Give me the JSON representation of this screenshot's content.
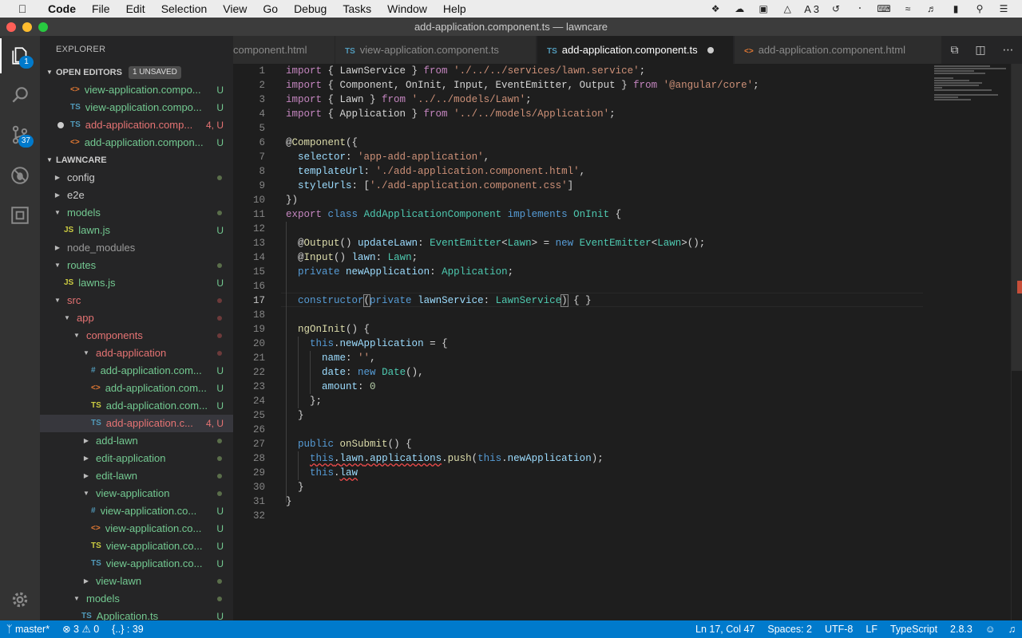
{
  "menubar": {
    "app": "Code",
    "items": [
      "File",
      "Edit",
      "Selection",
      "View",
      "Go",
      "Debug",
      "Tasks",
      "Window",
      "Help"
    ],
    "status_badge": "3"
  },
  "window": {
    "title": "add-application.component.ts — lawncare"
  },
  "activity": {
    "explorer_badge": "1",
    "scm_badge": "37"
  },
  "sidebar": {
    "title": "EXPLORER",
    "open_editors": {
      "label": "OPEN EDITORS",
      "unsaved": "1 UNSAVED",
      "items": [
        {
          "name": "view-application.compo...",
          "icon": "<>",
          "status": "U"
        },
        {
          "name": "view-application.compo...",
          "icon": "TS",
          "status": "U"
        },
        {
          "name": "add-application.comp...",
          "icon": "TS",
          "status": "4, U"
        },
        {
          "name": "add-application.compon...",
          "icon": "<>",
          "status": "U"
        }
      ]
    },
    "project": {
      "label": "LAWNCARE",
      "items": [
        {
          "name": "config"
        },
        {
          "name": "e2e"
        },
        {
          "name": "models"
        },
        {
          "name": "lawn.js",
          "icon": "JS",
          "status": "U"
        },
        {
          "name": "node_modules"
        },
        {
          "name": "routes"
        },
        {
          "name": "lawns.js",
          "icon": "JS",
          "status": "U"
        },
        {
          "name": "src"
        },
        {
          "name": "app"
        },
        {
          "name": "components"
        },
        {
          "name": "add-application"
        },
        {
          "name": "add-application.com...",
          "icon": "#",
          "status": "U"
        },
        {
          "name": "add-application.com...",
          "icon": "<>",
          "status": "U"
        },
        {
          "name": "add-application.com...",
          "icon": "TS",
          "status": "U"
        },
        {
          "name": "add-application.c...",
          "icon": "TS",
          "status": "4, U"
        },
        {
          "name": "add-lawn"
        },
        {
          "name": "edit-application"
        },
        {
          "name": "edit-lawn"
        },
        {
          "name": "view-application"
        },
        {
          "name": "view-application.co...",
          "icon": "#",
          "status": "U"
        },
        {
          "name": "view-application.co...",
          "icon": "<>",
          "status": "U"
        },
        {
          "name": "view-application.co...",
          "icon": "TS",
          "status": "U"
        },
        {
          "name": "view-application.co...",
          "icon": "TS",
          "status": "U"
        },
        {
          "name": "view-lawn"
        },
        {
          "name": "models"
        },
        {
          "name": "Application.ts",
          "icon": "TS",
          "status": "U"
        }
      ]
    }
  },
  "tabs": [
    {
      "label": "component.html",
      "icon": ""
    },
    {
      "label": "view-application.component.ts",
      "icon": "TS"
    },
    {
      "label": "add-application.component.ts",
      "icon": "TS"
    },
    {
      "label": "add-application.component.html",
      "icon": "<>"
    }
  ],
  "editor": {
    "line_numbers": [
      "1",
      "2",
      "3",
      "4",
      "5",
      "6",
      "7",
      "8",
      "9",
      "10",
      "11",
      "12",
      "13",
      "14",
      "15",
      "16",
      "17",
      "18",
      "19",
      "20",
      "21",
      "22",
      "23",
      "24",
      "25",
      "26",
      "27",
      "28",
      "29",
      "30",
      "31",
      "32"
    ]
  },
  "status": {
    "branch": "master*",
    "errors": "3",
    "warnings": "0",
    "braces": "{..} : 39",
    "position": "Ln 17, Col 47",
    "spaces": "Spaces: 2",
    "encoding": "UTF-8",
    "eol": "LF",
    "language": "TypeScript",
    "version": "2.8.3"
  },
  "colors": {
    "accent": "#007acc",
    "sidebar": "#252526",
    "editor": "#1e1e1e",
    "activity": "#333333"
  }
}
